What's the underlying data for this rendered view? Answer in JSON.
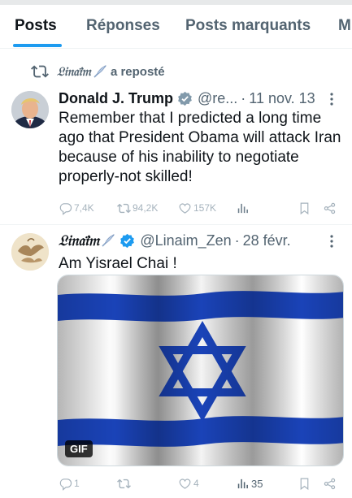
{
  "tabs": [
    {
      "label": "Posts",
      "active": true
    },
    {
      "label": "Réponses",
      "active": false
    },
    {
      "label": "Posts marquants",
      "active": false
    },
    {
      "label": "M",
      "active": false
    }
  ],
  "repost": {
    "reposter_name": "𝔏𝔦𝔫𝔞𝔦̈𝔪",
    "text": "a reposté"
  },
  "post1": {
    "author_name": "Donald J. Trump",
    "handle": "@re...",
    "separator": "·",
    "date": "11 nov. 13",
    "text": "Remember that I predicted a long time ago that President Obama will attack Iran because of his inability to negotiate properly-not skilled!",
    "actions": {
      "replies": "7,4K",
      "reposts": "94,2K",
      "likes": "157K",
      "views": ""
    }
  },
  "post2": {
    "author_name": "𝔏𝔦𝔫𝔞𝔦̈𝔪",
    "handle": "@Linaim_Zen",
    "separator": "·",
    "date": "28 févr.",
    "text": "Am Yisrael Chai !",
    "media_badge": "GIF",
    "actions": {
      "replies": "1",
      "reposts": "",
      "likes": "4",
      "views": "35"
    }
  },
  "colors": {
    "accent": "#1d9bf0",
    "muted": "#536471",
    "text": "#0f1419",
    "flag_blue": "#1a43b8"
  },
  "icons": [
    "repost-icon",
    "quill-icon",
    "verified-icon",
    "more-icon",
    "reply-icon",
    "like-icon",
    "views-icon",
    "bookmark-icon",
    "share-icon"
  ]
}
